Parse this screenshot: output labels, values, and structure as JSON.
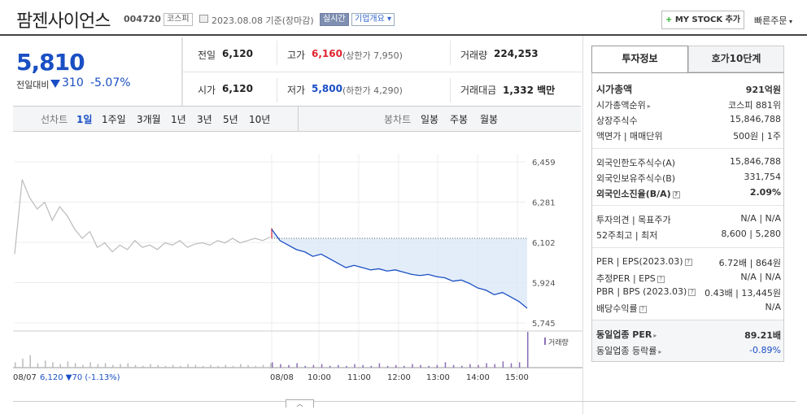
{
  "header": {
    "company_name": "팜젠사이언스",
    "stock_code": "004720",
    "market": "코스피",
    "date_text": "2023.08.08 기준(장마감)",
    "realtime_label": "실시간",
    "overview_label": "기업개요",
    "mystock_label": "MY STOCK 추가",
    "quick_order_label": "빠른주문"
  },
  "price": {
    "current": "5,810",
    "change_label": "전일대비",
    "change_value": "310",
    "change_pct": "-5.07%"
  },
  "quote": {
    "prev_close_label": "전일",
    "prev_close": "6,120",
    "open_label": "시가",
    "open": "6,120",
    "high_label": "고가",
    "high": "6,160",
    "upper_limit": "(상한가 7,950)",
    "low_label": "저가",
    "low": "5,800",
    "lower_limit": "(하한가 4,290)",
    "volume_label": "거래량",
    "volume": "224,253",
    "amount_label": "거래대금",
    "amount": "1,332 백만"
  },
  "periods": {
    "line_chart_label": "선차트",
    "items": [
      "1일",
      "1주일",
      "3개월",
      "1년",
      "3년",
      "5년",
      "10년"
    ],
    "candle_chart_label": "봉차트",
    "candle_items": [
      "일봉",
      "주봉",
      "월봉"
    ]
  },
  "chart_data": {
    "type": "line",
    "ylim": [
      5745,
      6459
    ],
    "y_ticks": [
      "6,459",
      "6,281",
      "6,102",
      "5,924",
      "5,745"
    ],
    "x_ticks": [
      "08/07",
      "08/08",
      "10:00",
      "11:00",
      "12:00",
      "13:00",
      "14:00",
      "15:00"
    ],
    "prev_day_label": "08/07",
    "prev_day_summary": "6,120 ▼70 (-1.13%)",
    "volume_legend": "거래량",
    "reference_price": 6120,
    "series": [
      {
        "values": [
          6050,
          6380,
          6300,
          6250,
          6280,
          6200,
          6260,
          6220,
          6160,
          6120,
          6150,
          6080,
          6100,
          6060,
          6090,
          6070,
          6110,
          6080,
          6090,
          6070,
          6100,
          6090,
          6110,
          6080,
          6095,
          6100,
          6090,
          6110,
          6100,
          6120,
          6100,
          6110,
          6120,
          6110,
          6125
        ]
      },
      {
        "values": [
          6160,
          6110,
          6090,
          6070,
          6060,
          6040,
          6050,
          6030,
          6010,
          5990,
          6000,
          5990,
          5980,
          5985,
          5975,
          5980,
          5970,
          5960,
          5955,
          5960,
          5950,
          5945,
          5930,
          5935,
          5920,
          5900,
          5890,
          5870,
          5880,
          5860,
          5840,
          5810
        ]
      }
    ],
    "volume_bars": {
      "prev_day": [
        6,
        10,
        14,
        5,
        8,
        6,
        4,
        7,
        5,
        3,
        6,
        4,
        5,
        3,
        4,
        5,
        3,
        2,
        4,
        3,
        2,
        3,
        2,
        4,
        3,
        2,
        3,
        2,
        3,
        2,
        4,
        3,
        2,
        3,
        5
      ],
      "today": [
        6,
        4,
        3,
        5,
        2,
        3,
        4,
        2,
        3,
        2,
        4,
        3,
        2,
        5,
        2,
        3,
        2,
        4,
        3,
        2,
        3,
        6,
        3,
        2,
        4,
        3,
        5,
        4,
        7,
        5,
        6,
        40
      ]
    }
  },
  "side": {
    "tab_invest": "투자정보",
    "tab_ask": "호가10단계",
    "rows": [
      {
        "label": "시가총액",
        "value": "921억원"
      },
      {
        "label": "시가총액순위",
        "value": "코스피 881위"
      },
      {
        "label": "상장주식수",
        "value": "15,846,788"
      },
      {
        "label": "액면가 | 매매단위",
        "value": "500원 | 1주"
      },
      {
        "label": "외국인한도주식수(A)",
        "value": "15,846,788"
      },
      {
        "label": "외국인보유주식수(B)",
        "value": "331,754"
      },
      {
        "label": "외국인소진율(B/A)",
        "value": "2.09%"
      },
      {
        "label": "투자의견 | 목표주가",
        "value": "N/A | N/A"
      },
      {
        "label": "52주최고 | 최저",
        "value": "8,600 | 5,280"
      },
      {
        "label": "PER | EPS(2023.03)",
        "value": "6.72배 | 864원"
      },
      {
        "label": "추정PER | EPS",
        "value": "N/A | N/A"
      },
      {
        "label": "PBR | BPS (2023.03)",
        "value": "0.43배 | 13,445원"
      },
      {
        "label": "배당수익률",
        "value": "N/A"
      },
      {
        "label": "동일업종 PER",
        "value": "89.21배"
      },
      {
        "label": "동일업종 등락률",
        "value": "-0.89%"
      }
    ]
  },
  "colors": {
    "down": "#1a4fc4",
    "up": "#e0242f",
    "fill": "#dce8f7"
  }
}
